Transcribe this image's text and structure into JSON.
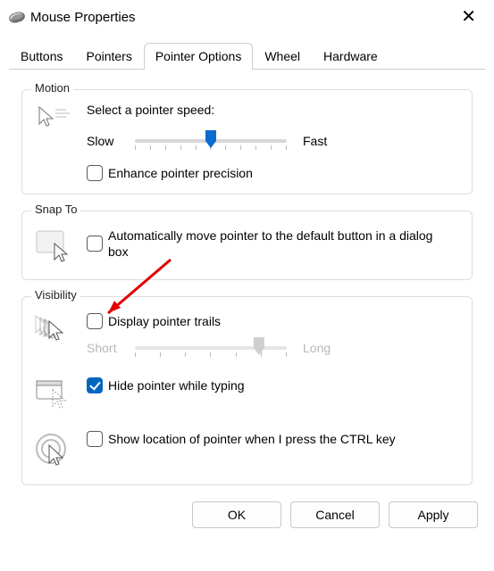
{
  "window": {
    "title": "Mouse Properties"
  },
  "tabs": [
    {
      "label": "Buttons"
    },
    {
      "label": "Pointers"
    },
    {
      "label": "Pointer Options",
      "active": true
    },
    {
      "label": "Wheel"
    },
    {
      "label": "Hardware"
    }
  ],
  "motion": {
    "legend": "Motion",
    "speed_label": "Select a pointer speed:",
    "slow": "Slow",
    "fast": "Fast",
    "speed_value_pct": 50,
    "enhance_label": "Enhance pointer precision",
    "enhance_checked": false
  },
  "snapto": {
    "legend": "Snap To",
    "auto_label": "Automatically move pointer to the default button in a dialog box",
    "auto_checked": false
  },
  "visibility": {
    "legend": "Visibility",
    "trails_label": "Display pointer trails",
    "trails_checked": false,
    "trails_short": "Short",
    "trails_long": "Long",
    "trails_value_pct": 82,
    "hide_label": "Hide pointer while typing",
    "hide_checked": true,
    "ctrl_label": "Show location of pointer when I press the CTRL key",
    "ctrl_checked": false
  },
  "buttons": {
    "ok": "OK",
    "cancel": "Cancel",
    "apply": "Apply"
  }
}
